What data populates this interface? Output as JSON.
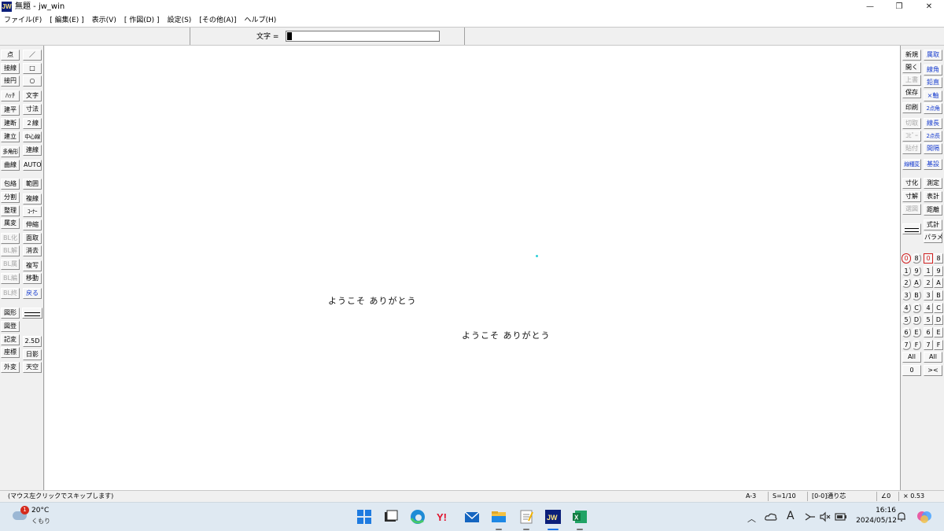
{
  "window": {
    "title": "無題 - jw_win",
    "app_icon_text": "JW",
    "minimize": "—",
    "maximize": "❐",
    "close": "✕"
  },
  "menu": [
    "ファイル(F)",
    "[ 編集(E) ]",
    "表示(V)",
    "[ 作図(D) ]",
    "設定(S)",
    "[その他(A)]",
    "ヘルプ(H)"
  ],
  "textbar": {
    "label": "文字 =",
    "value": ""
  },
  "left_tools": {
    "col1": [
      "点",
      "接線",
      "接円",
      "ﾊｯﾁ",
      "建平",
      "建断",
      "建立",
      "多角形",
      "曲線",
      "包絡",
      "分割",
      "整理",
      "属変",
      "BL化",
      "BL解",
      "BL属",
      "BL編",
      "BL終",
      "図形",
      "図登",
      "記変",
      "座標",
      "外変"
    ],
    "col2": [
      "／",
      "□",
      "○",
      "文字",
      "寸法",
      "２線",
      "中心線",
      "連線",
      "AUTO",
      "範囲",
      "複線",
      "ｺｰﾅｰ",
      "伸縮",
      "面取",
      "消去",
      "複写",
      "移動",
      "戻る",
      "2.5D",
      "日影",
      "天空"
    ]
  },
  "right_tools": {
    "col1": [
      "新規",
      "開く",
      "上書",
      "保存",
      "印刷",
      "切取",
      "ｺﾋﾟｰ",
      "貼付",
      "線種変",
      "寸化",
      "寸解",
      "選図",
      "式計"
    ],
    "col2": [
      "属取",
      "線角",
      "鉛直",
      "×軸",
      "2点角",
      "線長",
      "2点長",
      "間隔",
      "基設",
      "測定",
      "表計",
      "距離",
      "パラメ"
    ],
    "layer_groups": [
      "0",
      "1",
      "2",
      "3",
      "4",
      "5",
      "6",
      "7",
      "8",
      "9",
      "A",
      "B",
      "C",
      "D",
      "E",
      "F"
    ],
    "layers": [
      "0",
      "1",
      "2",
      "3",
      "4",
      "5",
      "6",
      "7",
      "8",
      "9",
      "A",
      "B",
      "C",
      "D",
      "E",
      "F"
    ],
    "all_label": "All",
    "zero_label": "0",
    "cross_label": "><"
  },
  "canvas": {
    "text1": "ようこそ ありがとう",
    "text2": "ようこそ ありがとう"
  },
  "status": {
    "message": "(マウス左クリックでスキップします)",
    "paper": "A-3",
    "scale": "S=1/10",
    "layer": "[0-0]通り芯",
    "angle": "∠0",
    "factor": "× 0.53"
  },
  "taskbar": {
    "weather_temp": "20°C",
    "weather_cond": "くもり",
    "weather_badge": "1",
    "ime": "A",
    "time": "16:16",
    "date": "2024/05/12"
  }
}
